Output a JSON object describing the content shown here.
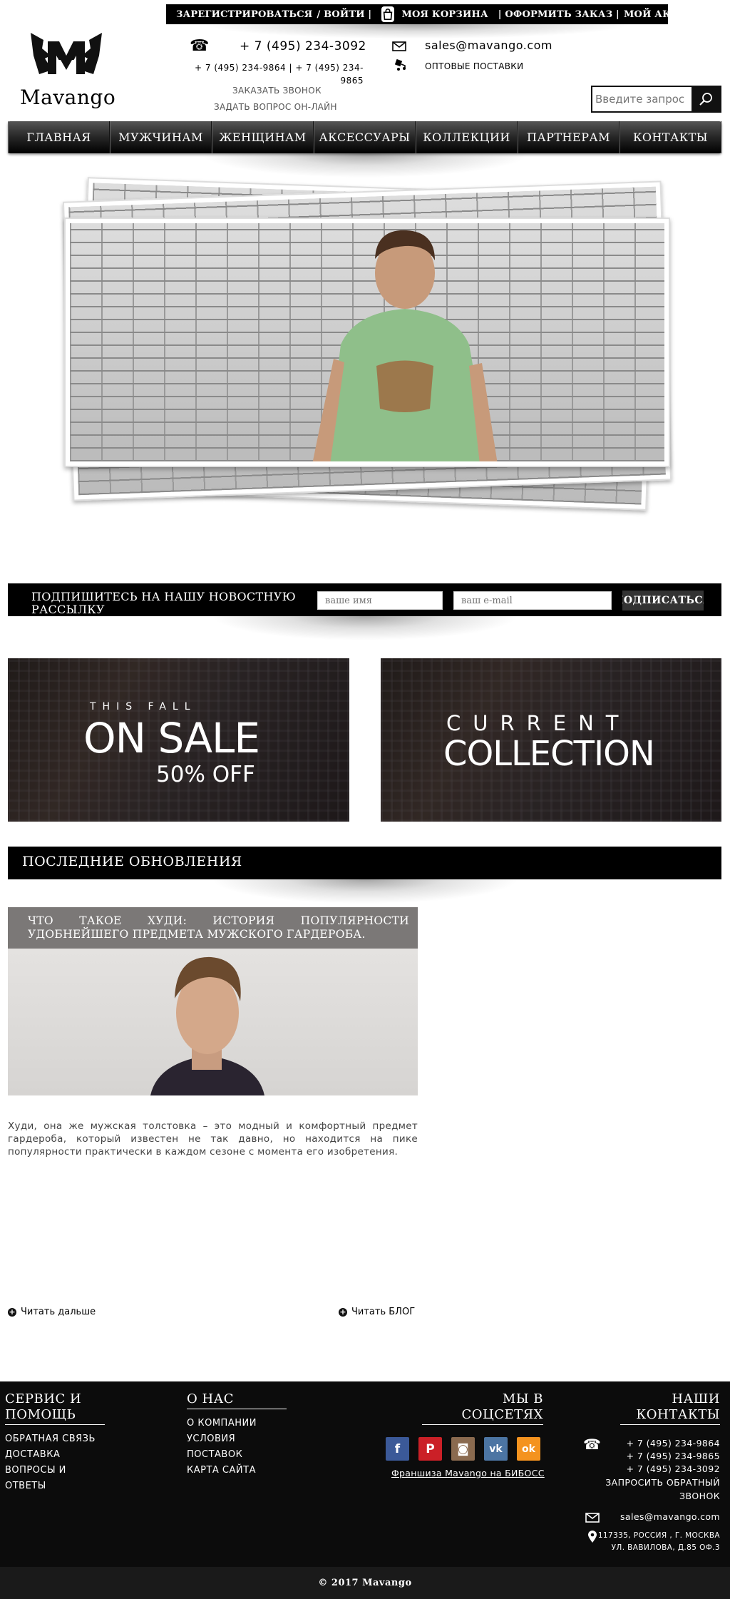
{
  "topbar": {
    "register": "ЗАРЕГИСТРИРОВАТЬСЯ",
    "login": "/ ВОЙТИ |",
    "cart": "МОЯ КОРЗИНА",
    "checkout": "| ОФОРМИТЬ ЗАКАЗ |",
    "account": "МОЙ АККАУНТ"
  },
  "header": {
    "logo_text": "Mavango",
    "phone_main": "+ 7 (495) 234-3092",
    "phone_alt_1": "+ 7 (495) 234-9864 | + 7 (495) 234-",
    "phone_alt_2": "9865",
    "callback": "ЗАКАЗАТЬ ЗВОНОК",
    "ask_online": "ЗАДАТЬ ВОПРОС ОН-ЛАЙН",
    "email": "sales@mavango.com",
    "wholesale": "ОПТОВЫЕ ПОСТАВКИ",
    "search_placeholder": "Введите запрос"
  },
  "nav": [
    "ГЛАВНАЯ",
    "МУЖЧИНАМ",
    "ЖЕНЩИНАМ",
    "АКСЕССУАРЫ",
    "КОЛЛЕКЦИИ",
    "ПАРТНЕРАМ",
    "КОНТАКТЫ"
  ],
  "subscribe": {
    "title": "ПОДПИШИТЕСЬ НА НАШУ НОВОСТНУЮ РАССЫЛКУ",
    "name_placeholder": "ваше имя",
    "email_placeholder": "ваш e-mail",
    "button": "ПОДПИСАТЬСЯ"
  },
  "banners": {
    "left": {
      "small": "THIS FALL",
      "big": "ON SALE",
      "sub": "50% OFF"
    },
    "right": {
      "small": "CURRENT",
      "big": "COLLECTION"
    }
  },
  "updates": {
    "heading": "ПОСЛЕДНИЕ ОБНОВЛЕНИЯ",
    "post_title": "ЧТО ТАКОЕ ХУДИ: ИСТОРИЯ ПОПУЛЯРНОСТИ УДОБНЕЙШЕГО ПРЕДМЕТА МУЖСКОГО ГАРДЕРОБА.",
    "post_text": "Худи, она же мужская толстовка – это модный и комфортный предмет гардероба, который известен не так давно, но находится на пике популярности практически в каждом сезоне с момента его изобретения.",
    "read_more": "Читать дальше",
    "read_blog": "Читать БЛОГ"
  },
  "footer": {
    "service_title": "СЕРВИС И ПОМОЩЬ",
    "service_links": [
      "ОБРАТНАЯ СВЯЗЬ",
      "ДОСТАВКА",
      "ВОПРОСЫ И",
      "ОТВЕТЫ"
    ],
    "about_title": "О НАС",
    "about_links": [
      "О КОМПАНИИ",
      "УСЛОВИЯ",
      "ПОСТАВОК",
      "КАРТА САЙТА"
    ],
    "social_title": "МЫ В СОЦСЕТЯХ",
    "social": [
      {
        "name": "facebook",
        "glyph": "f",
        "color": "#3b5998"
      },
      {
        "name": "pinterest",
        "glyph": "P",
        "color": "#cb2027"
      },
      {
        "name": "instagram",
        "glyph": "◙",
        "color": "#8a6a4f"
      },
      {
        "name": "vk",
        "glyph": "vk",
        "color": "#4c75a3"
      },
      {
        "name": "odnoklassniki",
        "glyph": "ok",
        "color": "#f4931f"
      }
    ],
    "franchise": "Франшиза Mavango на БИБОСС",
    "contacts_title": "НАШИ КОНТАКТЫ",
    "phones": [
      "+ 7 (495) 234-9864",
      "+ 7 (495) 234-9865",
      "+ 7 (495) 234-3092"
    ],
    "request_call": "ЗАПРОСИТЬ ОБРАТНЫЙ ЗВОНОК",
    "email": "sales@mavango.com",
    "address_1": "117335, РОССИЯ , Г. МОСКВА",
    "address_2": "УЛ. ВАВИЛОВА, Д.85 ОФ.3",
    "copyright": "© 2017 Mavango"
  }
}
